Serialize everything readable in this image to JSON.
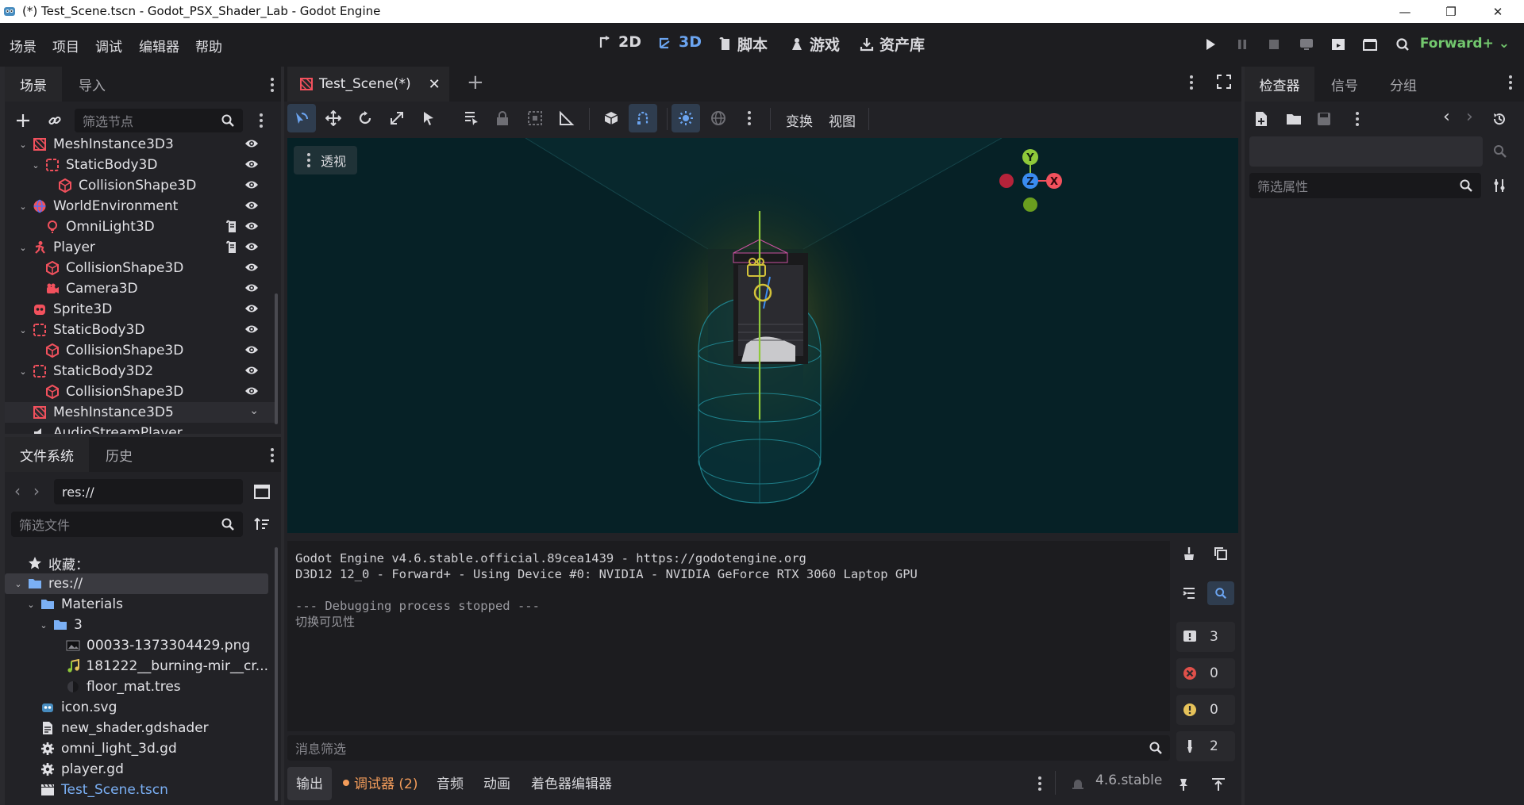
{
  "window": {
    "title": "(*) Test_Scene.tscn - Godot_PSX_Shader_Lab - Godot Engine"
  },
  "menu": [
    "场景",
    "项目",
    "调试",
    "编辑器",
    "帮助"
  ],
  "workspaces": [
    {
      "label": "2D",
      "icon": "2d-icon"
    },
    {
      "label": "3D",
      "icon": "3d-icon"
    },
    {
      "label": "脚本",
      "icon": "script-icon"
    },
    {
      "label": "游戏",
      "icon": "game-icon"
    },
    {
      "label": "资产库",
      "icon": "assetlib-icon"
    }
  ],
  "renderer": "Forward+ ⌄",
  "scene_dock": {
    "tabs": [
      "场景",
      "导入"
    ],
    "filter_placeholder": "筛选节点",
    "nodes": [
      {
        "label": "MeshInstance3D3",
        "depth": 0,
        "expanded": true,
        "icon": "mesh-instance-icon"
      },
      {
        "label": "StaticBody3D",
        "depth": 1,
        "expanded": true,
        "icon": "static-body-icon"
      },
      {
        "label": "CollisionShape3D",
        "depth": 2,
        "icon": "collision-shape-icon"
      },
      {
        "label": "WorldEnvironment",
        "depth": 0,
        "expanded": true,
        "icon": "world-environment-icon"
      },
      {
        "label": "OmniLight3D",
        "depth": 1,
        "icon": "omni-light-icon",
        "script": true
      },
      {
        "label": "Player",
        "depth": 0,
        "expanded": true,
        "icon": "player-icon",
        "script": true
      },
      {
        "label": "CollisionShape3D",
        "depth": 1,
        "icon": "collision-shape-icon"
      },
      {
        "label": "Camera3D",
        "depth": 1,
        "icon": "camera-icon"
      },
      {
        "label": "Sprite3D",
        "depth": 0,
        "icon": "sprite-icon"
      },
      {
        "label": "StaticBody3D",
        "depth": 0,
        "expanded": true,
        "icon": "static-body-icon"
      },
      {
        "label": "CollisionShape3D",
        "depth": 1,
        "icon": "collision-shape-icon"
      },
      {
        "label": "StaticBody3D2",
        "depth": 0,
        "expanded": true,
        "icon": "static-body-icon"
      },
      {
        "label": "CollisionShape3D",
        "depth": 1,
        "icon": "collision-shape-icon"
      },
      {
        "label": "MeshInstance3D5",
        "depth": 0,
        "icon": "mesh-instance-icon",
        "selected": true
      },
      {
        "label": "AudioStreamPlayer",
        "depth": 0,
        "icon": "audio-icon"
      }
    ]
  },
  "filesystem_dock": {
    "tabs": [
      "文件系统",
      "历史"
    ],
    "path": "res://",
    "filter_placeholder": "筛选文件",
    "items": [
      {
        "label": "收藏：",
        "depth": 0,
        "icon": "star-icon"
      },
      {
        "label": "res://",
        "depth": 0,
        "icon": "folder-icon",
        "expanded": true,
        "selected": true
      },
      {
        "label": "Materials",
        "depth": 1,
        "icon": "folder-icon",
        "expanded": true
      },
      {
        "label": "3",
        "depth": 2,
        "icon": "folder-icon",
        "expanded": true
      },
      {
        "label": "00033-1373304429.png",
        "depth": 3,
        "icon": "image-icon"
      },
      {
        "label": "181222__burning-mir__cr...",
        "depth": 3,
        "icon": "audio-file-icon"
      },
      {
        "label": "floor_mat.tres",
        "depth": 3,
        "icon": "material-icon"
      },
      {
        "label": "icon.svg",
        "depth": 1,
        "icon": "svg-icon"
      },
      {
        "label": "new_shader.gdshader",
        "depth": 1,
        "icon": "shader-icon"
      },
      {
        "label": "omni_light_3d.gd",
        "depth": 1,
        "icon": "gear-icon"
      },
      {
        "label": "player.gd",
        "depth": 1,
        "icon": "gear-icon"
      },
      {
        "label": "Test_Scene.tscn",
        "depth": 1,
        "icon": "scene-file-icon",
        "highlight": true
      }
    ]
  },
  "editor": {
    "scene_tab": "Test_Scene(*)",
    "toolbar": {
      "transform": "变换",
      "view": "视图"
    },
    "viewport_label": "透视",
    "gizmo": {
      "y": "Y",
      "z": "Z",
      "x": "X"
    }
  },
  "output": {
    "lines": [
      "Godot Engine v4.6.stable.official.89cea1439 - https://godotengine.org",
      "D3D12 12_0 - Forward+ - Using Device #0: NVIDIA - NVIDIA GeForce RTX 3060 Laptop GPU",
      "",
      "--- Debugging process stopped ---",
      "切换可见性"
    ],
    "filter_placeholder": "消息筛选",
    "counts": {
      "messages": "3",
      "errors": "0",
      "warnings": "0",
      "editor": "2"
    }
  },
  "bottom_tabs": [
    "输出",
    "调试器 (2)",
    "音频",
    "动画",
    "着色器编辑器"
  ],
  "version": "4.6.stable",
  "inspector": {
    "tabs": [
      "检查器",
      "信号",
      "分组"
    ],
    "filter_placeholder": "筛选属性"
  },
  "colors": {
    "accent": "#6ba4f0",
    "renderer": "#73c86e",
    "node_red": "#f2515d",
    "folder": "#7bb0f5",
    "debugger": "#f39c5a"
  }
}
